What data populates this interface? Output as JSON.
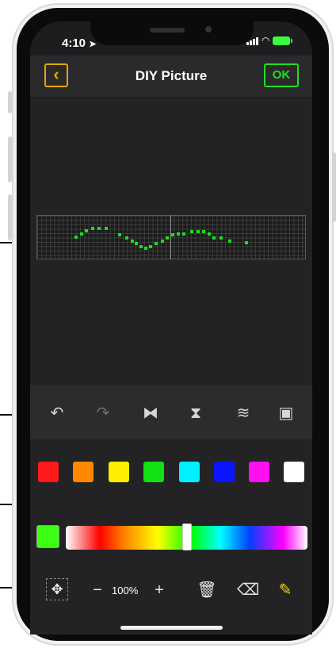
{
  "status_bar": {
    "time": "4:10"
  },
  "header": {
    "title": "DIY Picture",
    "back_icon": "chevron-left-icon",
    "ok_label": "OK"
  },
  "canvas": {
    "pixel_color": "#19e019",
    "pixels_filled": true
  },
  "toolbar": {
    "items": [
      {
        "name": "undo-icon",
        "glyph": "↶",
        "enabled": true
      },
      {
        "name": "redo-icon",
        "glyph": "↷",
        "enabled": false
      },
      {
        "name": "flip-horizontal-icon",
        "glyph": "⧓",
        "enabled": true
      },
      {
        "name": "flip-vertical-icon",
        "glyph": "⧗",
        "enabled": true
      },
      {
        "name": "layers-icon",
        "glyph": "≋",
        "enabled": true
      },
      {
        "name": "image-import-icon",
        "glyph": "▣",
        "enabled": true
      }
    ]
  },
  "palette": {
    "swatches": [
      "#ff1a1a",
      "#ff8800",
      "#ffee00",
      "#12e012",
      "#00f0ff",
      "#0a14ff",
      "#ff10f0",
      "#ffffff"
    ],
    "current_color": "#3cff14",
    "hue_position": 0.5
  },
  "bottom_bar": {
    "zoom_level": "100%",
    "zoom_out_glyph": "−",
    "zoom_in_glyph": "+",
    "move_icon": "move-arrows-icon",
    "delete_icon": "trash-icon",
    "eraser_icon": "eraser-icon",
    "pencil_icon": "pencil-icon"
  }
}
